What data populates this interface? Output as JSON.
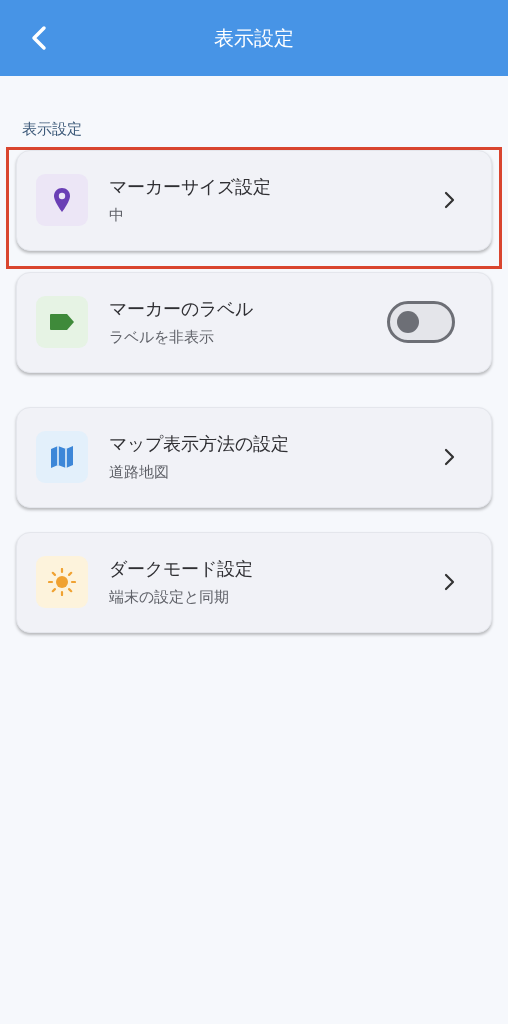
{
  "header": {
    "title": "表示設定"
  },
  "section": {
    "title": "表示設定"
  },
  "items": [
    {
      "kind": "link",
      "title": "マーカーサイズ設定",
      "subtitle": "中",
      "highlighted": true
    },
    {
      "kind": "toggle",
      "title": "マーカーのラベル",
      "subtitle": "ラベルを非表示",
      "highlighted": false,
      "on": false
    },
    {
      "kind": "link",
      "title": "マップ表示方法の設定",
      "subtitle": "道路地図",
      "highlighted": false
    },
    {
      "kind": "link",
      "title": "ダークモード設定",
      "subtitle": "端末の設定と同期",
      "highlighted": false
    }
  ]
}
